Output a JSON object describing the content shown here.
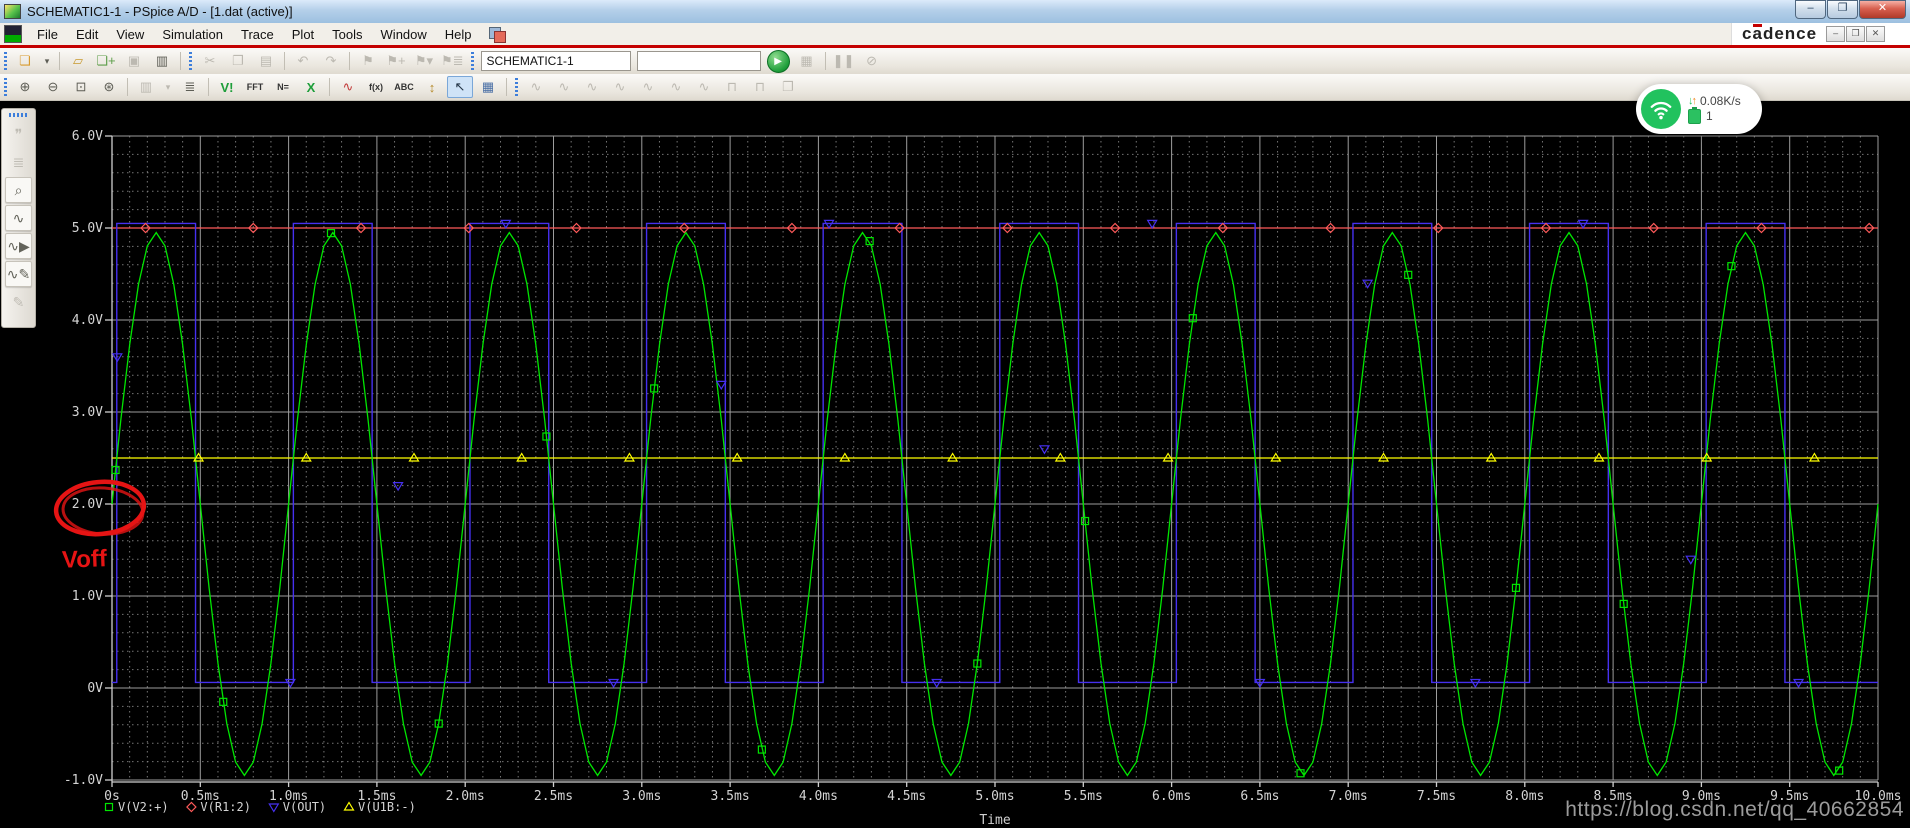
{
  "window": {
    "title": "SCHEMATIC1-1 - PSpice A/D  - [1.dat (active)]",
    "buttons": {
      "minimize": "–",
      "restore": "❐",
      "close": "✕"
    }
  },
  "menubar": {
    "items": [
      "File",
      "Edit",
      "View",
      "Simulation",
      "Trace",
      "Plot",
      "Tools",
      "Window",
      "Help"
    ]
  },
  "brand": {
    "l1": "c",
    "l2": "a",
    "l3": "dence",
    "mdi": {
      "minimize": "–",
      "restore": "❐",
      "close": "✕"
    }
  },
  "toolbar1": {
    "schematic_field": "SCHEMATIC1-1",
    "profile_field": "",
    "run_glyph": "▶",
    "items": [
      {
        "type": "grip"
      },
      {
        "type": "icon",
        "name": "new-file-button",
        "glyph": "❏",
        "color": "#d89a2e",
        "state": "enabled"
      },
      {
        "type": "icon",
        "name": "new-file-dropdown",
        "glyph": "▾",
        "state": "enabled",
        "narrow": true
      },
      {
        "type": "sep"
      },
      {
        "type": "icon",
        "name": "open-file-button",
        "glyph": "▱",
        "color": "#c8992f",
        "state": "enabled"
      },
      {
        "type": "icon",
        "name": "append-waveform-button",
        "glyph": "❏+",
        "color": "#5d9e4a",
        "state": "enabled"
      },
      {
        "type": "icon",
        "name": "save-button",
        "glyph": "▣",
        "state": "disabled"
      },
      {
        "type": "icon",
        "name": "print-button",
        "glyph": "▥",
        "state": "enabled"
      },
      {
        "type": "sep"
      },
      {
        "type": "grip"
      },
      {
        "type": "icon",
        "name": "cut-button",
        "glyph": "✂",
        "state": "disabled"
      },
      {
        "type": "icon",
        "name": "copy-button",
        "glyph": "❐",
        "state": "disabled"
      },
      {
        "type": "icon",
        "name": "paste-button",
        "glyph": "▤",
        "state": "disabled"
      },
      {
        "type": "sep"
      },
      {
        "type": "icon",
        "name": "undo-button",
        "glyph": "↶",
        "state": "disabled"
      },
      {
        "type": "icon",
        "name": "redo-button",
        "glyph": "↷",
        "state": "disabled"
      },
      {
        "type": "sep"
      },
      {
        "type": "icon",
        "name": "bookmark-button",
        "glyph": "⚑",
        "state": "disabled"
      },
      {
        "type": "icon",
        "name": "label-state-button",
        "glyph": "⚑+",
        "state": "disabled"
      },
      {
        "type": "icon",
        "name": "restore-state-button",
        "glyph": "⚑▾",
        "state": "disabled"
      },
      {
        "type": "icon",
        "name": "manage-states-button",
        "glyph": "⚑≣",
        "state": "disabled"
      },
      {
        "type": "grip"
      },
      {
        "type": "field",
        "name": "schematic-select-field",
        "bind": "toolbar1.schematic_field",
        "width": 138
      },
      {
        "type": "field",
        "name": "profile-select-field",
        "bind": "toolbar1.profile_field",
        "width": 112
      },
      {
        "type": "run",
        "name": "run-simulation-button"
      },
      {
        "type": "icon",
        "name": "edit-simulation-profile-button",
        "glyph": "▦",
        "state": "disabled"
      },
      {
        "type": "sep"
      },
      {
        "type": "icon",
        "name": "pause-simulation-button",
        "glyph": "❚❚",
        "state": "disabled"
      },
      {
        "type": "icon",
        "name": "stop-simulation-button",
        "glyph": "⊘",
        "state": "disabled"
      }
    ]
  },
  "toolbar2": {
    "items": [
      {
        "type": "grip"
      },
      {
        "type": "icon",
        "name": "zoom-in-button",
        "glyph": "⊕",
        "state": "enabled"
      },
      {
        "type": "icon",
        "name": "zoom-out-button",
        "glyph": "⊖",
        "state": "enabled"
      },
      {
        "type": "icon",
        "name": "zoom-area-button",
        "glyph": "⊡",
        "state": "enabled"
      },
      {
        "type": "icon",
        "name": "zoom-fit-button",
        "glyph": "⊛",
        "state": "enabled"
      },
      {
        "type": "sep"
      },
      {
        "type": "icon",
        "name": "print-preview-button",
        "glyph": "▥",
        "state": "disabled"
      },
      {
        "type": "icon",
        "name": "preview-dropdown",
        "glyph": "▾",
        "state": "disabled",
        "narrow": true
      },
      {
        "type": "icon",
        "name": "log-viewer-button",
        "glyph": "≣",
        "state": "enabled"
      },
      {
        "type": "sep"
      },
      {
        "type": "icon",
        "name": "view-output-file-button",
        "glyph": "V!",
        "color": "#1e9e3a",
        "state": "enabled",
        "bold": true
      },
      {
        "type": "icon",
        "name": "fft-button",
        "glyph": "FFT",
        "color": "#333333",
        "state": "enabled",
        "small": true
      },
      {
        "type": "icon",
        "name": "eval-measurement-button",
        "glyph": "N=",
        "color": "#333333",
        "state": "enabled",
        "small": true
      },
      {
        "type": "icon",
        "name": "close-plot-button",
        "glyph": "X",
        "color": "#1e9e3a",
        "state": "enabled",
        "bold": true
      },
      {
        "type": "sep"
      },
      {
        "type": "icon",
        "name": "add-trace-button",
        "glyph": "∿",
        "color": "#c23a3a",
        "state": "enabled"
      },
      {
        "type": "icon",
        "name": "eval-goal-function-button",
        "glyph": "f(x)",
        "color": "#333333",
        "state": "enabled",
        "small": true
      },
      {
        "type": "icon",
        "name": "insert-text-label-button",
        "glyph": "ABC",
        "color": "#333333",
        "state": "enabled",
        "small": true
      },
      {
        "type": "icon",
        "name": "add-y-axis-button",
        "glyph": "↕",
        "color": "#b58a2a",
        "state": "enabled"
      },
      {
        "type": "icon",
        "name": "cursor-toggle-button",
        "glyph": "↖",
        "state": "active"
      },
      {
        "type": "icon",
        "name": "mesh-display-button",
        "glyph": "▦",
        "color": "#4a6fa5",
        "state": "enabled"
      },
      {
        "type": "sep"
      },
      {
        "type": "grip"
      },
      {
        "type": "icon",
        "name": "cursor-peak-button",
        "glyph": "∿",
        "state": "disabled"
      },
      {
        "type": "icon",
        "name": "cursor-trough-button",
        "glyph": "∿",
        "state": "disabled"
      },
      {
        "type": "icon",
        "name": "cursor-slope-button",
        "glyph": "∿",
        "state": "disabled"
      },
      {
        "type": "icon",
        "name": "cursor-min-button",
        "glyph": "∿",
        "state": "disabled"
      },
      {
        "type": "icon",
        "name": "cursor-max-button",
        "glyph": "∿",
        "state": "disabled"
      },
      {
        "type": "icon",
        "name": "cursor-point-button",
        "glyph": "∿",
        "state": "disabled"
      },
      {
        "type": "icon",
        "name": "cursor-search-button",
        "glyph": "∿",
        "state": "disabled"
      },
      {
        "type": "icon",
        "name": "next-transition-button",
        "glyph": "⊓",
        "state": "disabled"
      },
      {
        "type": "icon",
        "name": "prev-transition-button",
        "glyph": "⊓",
        "state": "disabled"
      },
      {
        "type": "icon",
        "name": "copy-plot-button",
        "glyph": "❐",
        "state": "disabled"
      }
    ]
  },
  "sidebar": {
    "items": [
      {
        "name": "comment-tool",
        "glyph": "❞",
        "state": "disabled"
      },
      {
        "name": "netlist-viewer-tool",
        "glyph": "≣",
        "state": "disabled"
      },
      {
        "name": "find-in-output-tool",
        "glyph": "⌕",
        "state": "enabled"
      },
      {
        "name": "view-waveform-tool",
        "glyph": "∿",
        "state": "enabled"
      },
      {
        "name": "run-batch-tool",
        "glyph": "∿▶",
        "state": "enabled"
      },
      {
        "name": "edit-stimulus-tool",
        "glyph": "∿✎",
        "state": "enabled"
      },
      {
        "name": "edit-model-tool",
        "glyph": "✎",
        "state": "disabled"
      }
    ]
  },
  "overlay": {
    "speed": "0.08K/s",
    "count": "1",
    "arrow_down": "↓",
    "arrow_up": "↑"
  },
  "annotation": {
    "voff_label": "Voff",
    "circled_y_label": "2.0V",
    "color": "#e61414"
  },
  "watermark": "https://blog.csdn.net/qq_40662854",
  "chart_data": {
    "type": "line",
    "title": "",
    "xlabel": "Time",
    "ylabel": "",
    "x_range_ms": [
      0,
      10
    ],
    "y_range_v": [
      -1,
      6
    ],
    "x_ticks": [
      "0s",
      "0.5ms",
      "1.0ms",
      "1.5ms",
      "2.0ms",
      "2.5ms",
      "3.0ms",
      "3.5ms",
      "4.0ms",
      "4.5ms",
      "5.0ms",
      "5.5ms",
      "6.0ms",
      "6.5ms",
      "7.0ms",
      "7.5ms",
      "8.0ms",
      "8.5ms",
      "9.0ms",
      "9.5ms",
      "10.0ms"
    ],
    "x_tick_values_ms": [
      0,
      0.5,
      1,
      1.5,
      2,
      2.5,
      3,
      3.5,
      4,
      4.5,
      5,
      5.5,
      6,
      6.5,
      7,
      7.5,
      8,
      8.5,
      9,
      9.5,
      10
    ],
    "y_ticks": [
      "6.0V",
      "5.0V",
      "4.0V",
      "3.0V",
      "2.0V",
      "1.0V",
      "0V",
      "-1.0V"
    ],
    "y_tick_values_v": [
      6,
      5,
      4,
      3,
      2,
      1,
      0,
      -1
    ],
    "grid": {
      "minor_x_ms": 0.1,
      "minor_y_v": 0.2,
      "major_color": "#9d9d9d",
      "minor_color": "#8a8a8a",
      "axis_color": "#cfcfcf",
      "label_color": "#d4d4d4"
    },
    "legend_position": "bottom-left",
    "series": [
      {
        "name": "V(V2:+)",
        "color": "#00e600",
        "marker": "square",
        "kind": "sine",
        "offset_v": 2.0,
        "amplitude_v": 2.95,
        "period_ms": 1.0,
        "marker_t_ms": [
          0.02,
          0.63,
          1.24,
          1.85,
          2.46,
          3.07,
          3.68,
          4.29,
          4.9,
          5.51,
          6.12,
          6.73,
          7.34,
          7.95,
          8.56,
          9.17,
          9.78
        ]
      },
      {
        "name": "V(R1:2)",
        "color": "#ff5a5a",
        "marker": "diamond",
        "kind": "const",
        "value_v": 5.0,
        "marker_t_ms": [
          0.19,
          0.8,
          1.41,
          2.02,
          2.63,
          3.24,
          3.85,
          4.46,
          5.07,
          5.68,
          6.29,
          6.9,
          7.51,
          8.12,
          8.73,
          9.34,
          9.95
        ]
      },
      {
        "name": "V(OUT)",
        "color": "#4630f0",
        "marker": "triangle-down",
        "kind": "square",
        "high_v": 5.05,
        "low_v": 0.06,
        "rise_frac": 0.027,
        "fall_frac": 0.473,
        "period_ms": 1.0,
        "marker_points": [
          [
            0.03,
            3.6
          ],
          [
            1.01,
            0.06
          ],
          [
            1.62,
            2.2
          ],
          [
            2.23,
            5.05
          ],
          [
            2.84,
            0.06
          ],
          [
            3.45,
            3.3
          ],
          [
            4.06,
            5.05
          ],
          [
            4.67,
            0.06
          ],
          [
            5.28,
            2.6
          ],
          [
            5.89,
            5.05
          ],
          [
            6.5,
            0.06
          ],
          [
            7.11,
            4.4
          ],
          [
            7.72,
            0.06
          ],
          [
            8.33,
            5.05
          ],
          [
            8.94,
            1.4
          ],
          [
            9.55,
            0.06
          ]
        ]
      },
      {
        "name": "V(U1B:-)",
        "color": "#ffff00",
        "marker": "triangle-up",
        "kind": "const",
        "value_v": 2.5,
        "marker_t_ms": [
          0.49,
          1.1,
          1.71,
          2.32,
          2.93,
          3.54,
          4.15,
          4.76,
          5.37,
          5.98,
          6.59,
          7.2,
          7.81,
          8.42,
          9.03,
          9.64
        ]
      }
    ]
  }
}
